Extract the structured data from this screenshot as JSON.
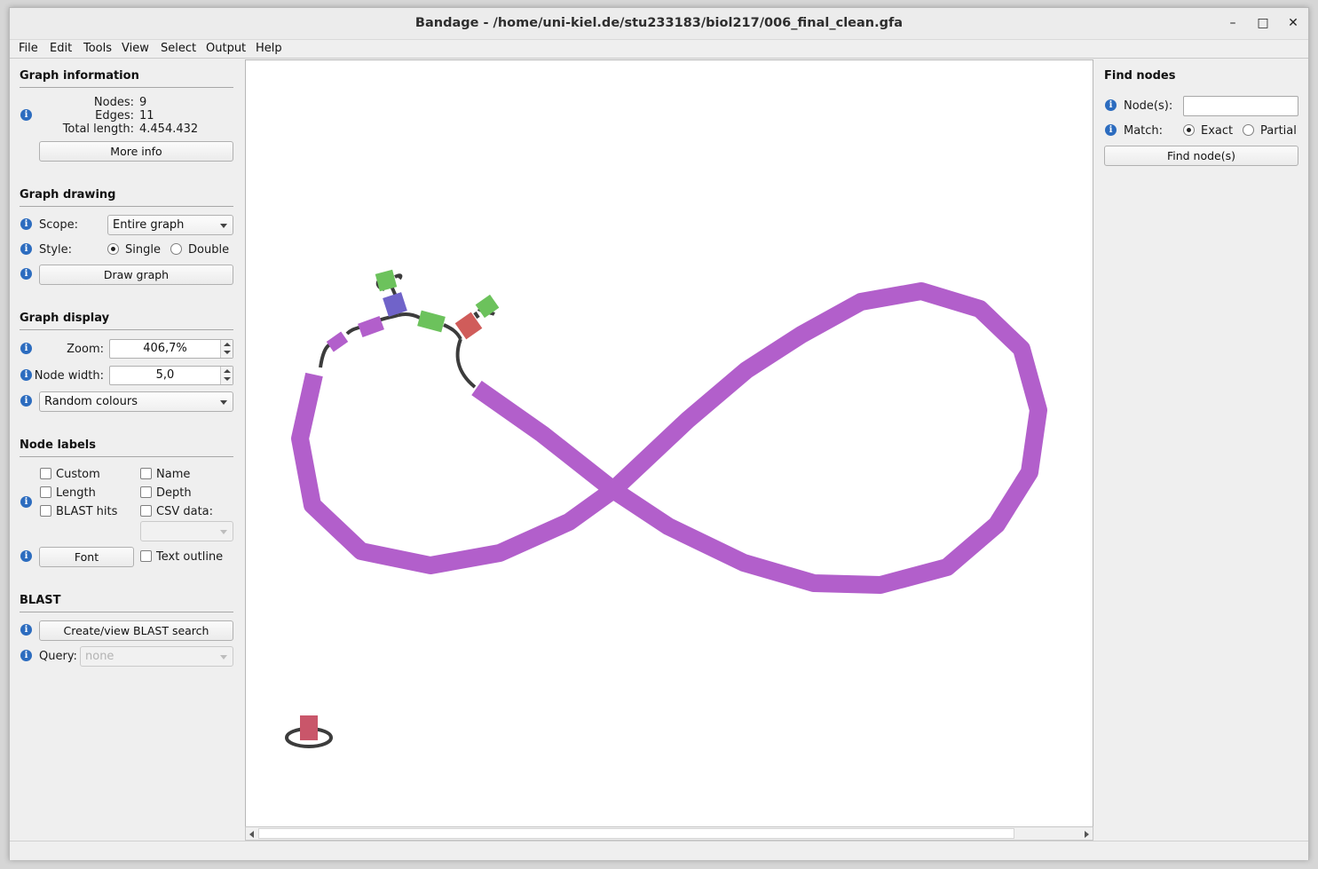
{
  "window": {
    "title": "Bandage - /home/uni-kiel.de/stu233183/biol217/006_final_clean.gfa",
    "minimize_glyph": "–",
    "maximize_glyph": "□",
    "close_glyph": "✕"
  },
  "menubar": [
    "File",
    "Edit",
    "Tools",
    "View",
    "Select",
    "Output",
    "Help"
  ],
  "graph_information": {
    "title": "Graph information",
    "nodes_label": "Nodes:",
    "nodes_value": "9",
    "edges_label": "Edges:",
    "edges_value": "11",
    "length_label": "Total length:",
    "length_value": "4.454.432",
    "more_info": "More info"
  },
  "graph_drawing": {
    "title": "Graph drawing",
    "scope_label": "Scope:",
    "scope_value": "Entire graph",
    "style_label": "Style:",
    "style_single": "Single",
    "style_double": "Double",
    "style_selected": "Single",
    "draw_graph": "Draw graph"
  },
  "graph_display": {
    "title": "Graph display",
    "zoom_label": "Zoom:",
    "zoom_value": "406,7%",
    "node_width_label": "Node width:",
    "node_width_value": "5,0",
    "colour_scheme": "Random colours"
  },
  "node_labels": {
    "title": "Node labels",
    "custom": "Custom",
    "name": "Name",
    "length": "Length",
    "depth": "Depth",
    "blast_hits": "BLAST hits",
    "csv_data": "CSV data:",
    "font": "Font",
    "text_outline": "Text outline"
  },
  "blast": {
    "title": "BLAST",
    "create_view": "Create/view BLAST search",
    "query_label": "Query:",
    "query_value": "none"
  },
  "find_nodes": {
    "title": "Find nodes",
    "nodes_label": "Node(s):",
    "match_label": "Match:",
    "exact": "Exact",
    "partial": "Partial",
    "match_selected": "Exact",
    "find_button": "Find node(s)"
  },
  "info_icon_glyph": "i",
  "colors": {
    "main_contig": "#b25fcb",
    "edge": "#3c3c3c",
    "node_green": "#6cc25c",
    "node_blue": "#7063c9",
    "node_red": "#d05c5a",
    "node_pink": "#c9566a",
    "accent_info": "#2c6cbf"
  }
}
